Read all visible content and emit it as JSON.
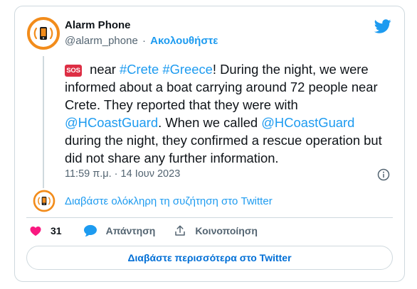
{
  "author": {
    "name": "Alarm Phone",
    "handle": "@alarm_phone",
    "separator": "·",
    "follow_label": "Ακολουθήστε"
  },
  "tweet": {
    "sos_badge": "SOS",
    "segments": [
      {
        "text": " near ",
        "type": "text"
      },
      {
        "text": "#Crete",
        "type": "link"
      },
      {
        "text": " ",
        "type": "text"
      },
      {
        "text": "#Greece",
        "type": "link"
      },
      {
        "text": "! During the night, we were informed about a boat carrying around 72 people near Crete. They reported that they were with ",
        "type": "text"
      },
      {
        "text": "@HCoastGuard",
        "type": "link"
      },
      {
        "text": ". When we called ",
        "type": "text"
      },
      {
        "text": "@HCoastGuard",
        "type": "link"
      },
      {
        "text": " during the night, they confirmed a rescue operation but did not share any further information.",
        "type": "text"
      }
    ],
    "timestamp": "11:59 π.μ. · 14 Ιουν 2023"
  },
  "thread_link": "Διαβάστε ολόκληρη τη συζήτηση στο Twitter",
  "actions": {
    "like_count": "31",
    "reply_label": "Απάντηση",
    "share_label": "Κοινοποίηση"
  },
  "read_more_label": "Διαβάστε περισσότερα στο Twitter",
  "colors": {
    "link": "#1d9bf0",
    "like": "#f91880",
    "avatar_orange": "#f28c1b",
    "sos_red": "#dd2e44"
  },
  "icons": [
    "alarm-phone-logo-icon",
    "twitter-bird-icon",
    "info-icon",
    "heart-icon",
    "reply-bubble-icon",
    "share-icon"
  ]
}
